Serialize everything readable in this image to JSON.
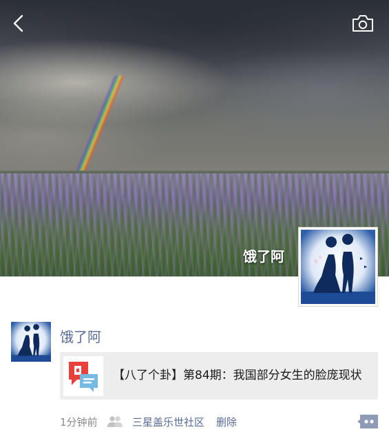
{
  "cover": {
    "owner_name": "饿了阿"
  },
  "header": {
    "back_icon": "chevron-left-icon",
    "camera_icon": "camera-icon"
  },
  "post": {
    "author": "饿了阿",
    "link": {
      "title": "【八了个卦】第84期：我国部分女生的脸庞现状",
      "thumb_icon": "chat-bubbles-icon"
    },
    "time": "1分钟前",
    "visibility_icon": "friends-icon",
    "source": "三星盖乐世社区",
    "delete_label": "删除",
    "comment_icon": "comment-dots-icon"
  },
  "colors": {
    "name_link": "#576b95",
    "card_bg": "#ededed",
    "meta_gray": "#8a8a8a"
  }
}
